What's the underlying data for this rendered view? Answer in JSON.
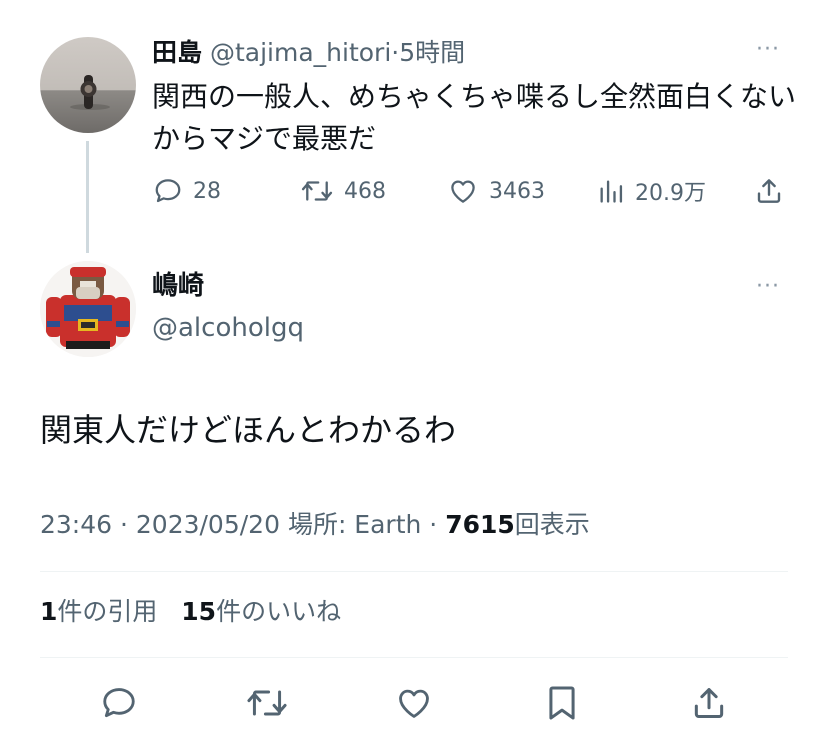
{
  "parent_tweet": {
    "display_name": "田島",
    "handle": "@tajima_hitori",
    "separator": "·",
    "time_ago": "5時間",
    "text": "関西の一般人、めちゃくちゃ喋るし全然面白くないからマジで最悪だ",
    "more": "···",
    "replies": "28",
    "retweets": "468",
    "likes": "3463",
    "views": "20.9万"
  },
  "main_tweet": {
    "display_name": "嶋崎",
    "handle": "@alcoholgq",
    "more": "···",
    "text": "関東人だけどほんとわかるわ",
    "time": "23:46",
    "sep1": " · ",
    "date": "2023/05/20",
    "location_label": "場所: Earth",
    "sep2": " · ",
    "view_count": "7615",
    "view_label": "回表示",
    "quote_count": "1",
    "quote_label": "件の引用",
    "like_count": "15",
    "like_label": "件のいいね"
  },
  "colors": {
    "text_primary": "#0f1419",
    "text_secondary": "#536471",
    "divider": "#eff3f4",
    "thread_line": "#cfd9de"
  },
  "icons": {
    "reply": "reply-icon",
    "retweet": "retweet-icon",
    "like": "heart-icon",
    "views": "views-icon",
    "share": "share-icon",
    "bookmark": "bookmark-icon",
    "more": "more-icon"
  }
}
